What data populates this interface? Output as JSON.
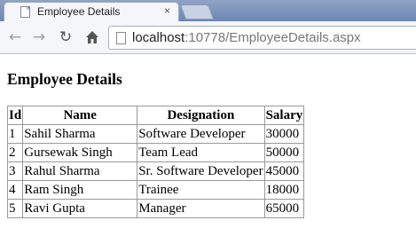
{
  "browser": {
    "tab": {
      "title": "Employee Details",
      "close": "×"
    },
    "toolbar": {
      "back_icon": "back-arrow-icon",
      "forward_icon": "forward-arrow-icon",
      "reload_icon": "reload-icon",
      "home_icon": "home-icon"
    },
    "address": {
      "host": "localhost",
      "rest": ":10778/EmployeeDetails.aspx"
    }
  },
  "page": {
    "title": "Employee Details",
    "table": {
      "headers": [
        "Id",
        "Name",
        "Designation",
        "Salary"
      ],
      "rows": [
        [
          "1",
          "Sahil Sharma",
          "Software Developer",
          "30000"
        ],
        [
          "2",
          "Gursewak Singh",
          "Team Lead",
          "50000"
        ],
        [
          "3",
          "Rahul Sharma",
          "Sr. Software Developer",
          "45000"
        ],
        [
          "4",
          "Ram Singh",
          "Trainee",
          "18000"
        ],
        [
          "5",
          "Ravi Gupta",
          "Manager",
          "65000"
        ]
      ]
    }
  }
}
